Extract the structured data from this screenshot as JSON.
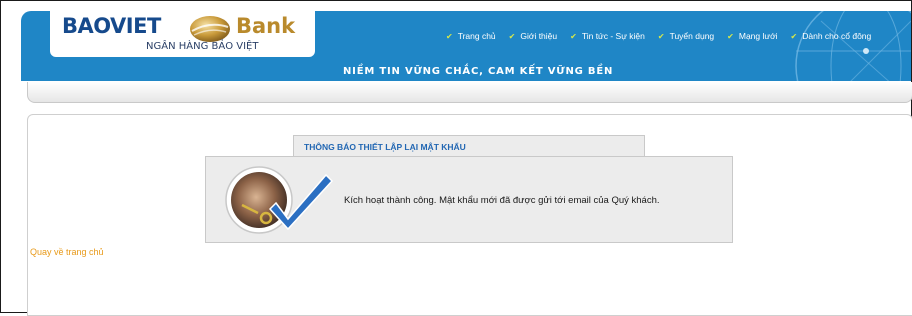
{
  "brand": {
    "name_part1": "BAOVIET",
    "name_part2": "Bank",
    "tagline": "NGÂN HÀNG BẢO VIỆT"
  },
  "header": {
    "slogan": "NIỀM TIN VỮNG CHẮC, CAM KẾT VỮNG BỀN",
    "nav": [
      {
        "label": "Trang chủ"
      },
      {
        "label": "Giới thiệu"
      },
      {
        "label": "Tin tức - Sự kiện"
      },
      {
        "label": "Tuyển dụng"
      },
      {
        "label": "Mạng lưới"
      },
      {
        "label": "Dành cho cổ đông"
      }
    ]
  },
  "notice": {
    "title": "THÔNG BÁO THIẾT LẬP LẠI MẬT KHẨU",
    "message": "Kích hoạt thành công. Mật khẩu mới đã được gửi tới email của Quý khách."
  },
  "links": {
    "home": "Quay về trang chủ"
  },
  "colors": {
    "header_blue": "#1f86c6",
    "brand_navy": "#164a8c",
    "brand_gold": "#b98a2c",
    "notice_title_blue": "#2267b3",
    "link_orange": "#e89a1a"
  }
}
